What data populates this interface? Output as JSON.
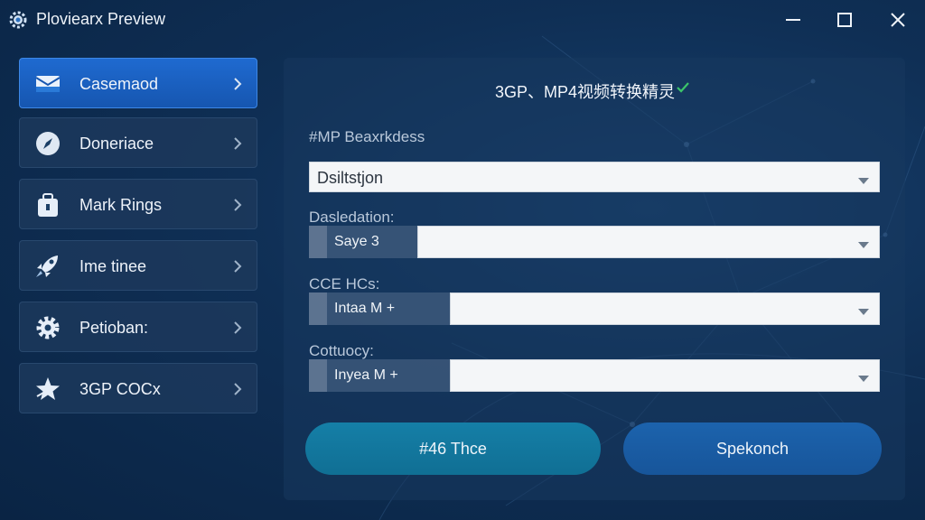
{
  "window": {
    "title": "Ploviearx Preview",
    "icons": {
      "app": "gear-app-icon",
      "minimize": "minimize-icon",
      "maximize": "maximize-icon",
      "close": "close-icon"
    }
  },
  "sidebar": {
    "items": [
      {
        "label": "Casemaod",
        "icon": "envelope-icon",
        "active": true
      },
      {
        "label": "Doneriace",
        "icon": "compass-icon",
        "active": false
      },
      {
        "label": "Mark Rings",
        "icon": "bag-icon",
        "active": false
      },
      {
        "label": "Ime tinee",
        "icon": "rocket-icon",
        "active": false
      },
      {
        "label": "Petioban:",
        "icon": "gear-icon",
        "active": false
      },
      {
        "label": "3GP COCx",
        "icon": "star-icon",
        "active": false
      }
    ]
  },
  "main": {
    "title": "3GP、MP4视频转换精灵",
    "fields": [
      {
        "label": "#MP Beaxrkdess",
        "value": "Dsiltstjon"
      },
      {
        "label": "Dasledation:",
        "value": "Saye 3"
      },
      {
        "label": "CCE HCs:",
        "value": "Intaa M +"
      },
      {
        "label": "Cottuocy:",
        "value": "Inyea M +"
      }
    ],
    "buttons": {
      "primary": "#46 Thce",
      "secondary": "Spekonch"
    }
  },
  "colors": {
    "background": "#0d2a4d",
    "sidebar_active": "#1f6ad0",
    "primary_button": "#157fa7",
    "secondary_button": "#1c63ad",
    "check": "#3cc46a"
  }
}
